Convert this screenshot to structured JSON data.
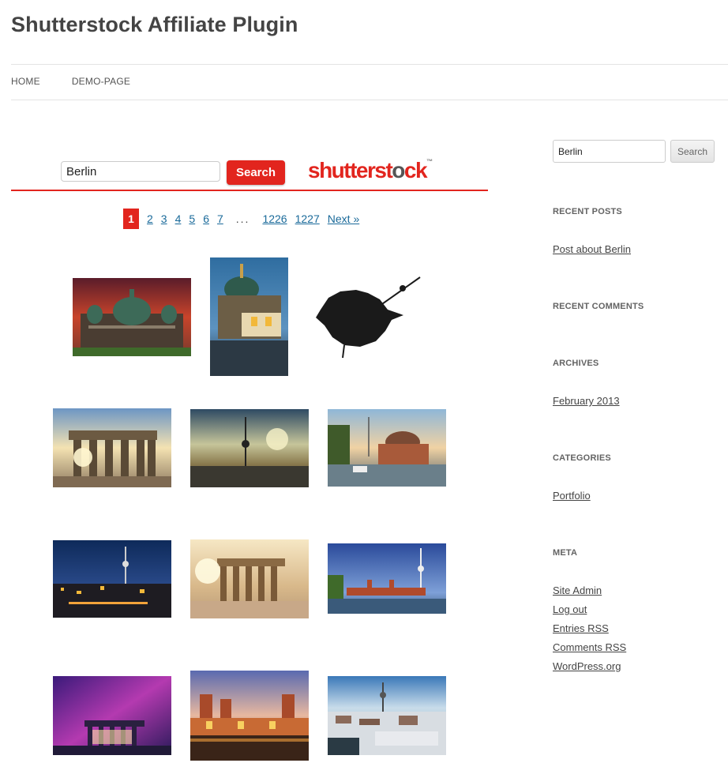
{
  "site": {
    "title": "Shutterstock Affiliate Plugin"
  },
  "nav": {
    "items": [
      "HOME",
      "DEMO-PAGE"
    ]
  },
  "widget": {
    "search_value": "Berlin",
    "search_button": "Search",
    "logo_red": "shutterst",
    "logo_grey1": "o",
    "logo_red2": "ck",
    "brand_color": "#e2251e"
  },
  "pager": {
    "current": "1",
    "pages": [
      "2",
      "3",
      "4",
      "5",
      "6",
      "7"
    ],
    "dots": "...",
    "last_pages": [
      "1226",
      "1227"
    ],
    "next": "Next »"
  },
  "images": [
    {
      "subject": "berlin-cathedral-red-sky"
    },
    {
      "subject": "berlin-cathedral-river"
    },
    {
      "subject": "berlin-silhouette-tv-tower"
    },
    {
      "subject": "brandenburg-gate-sunrise"
    },
    {
      "subject": "tv-tower-skyline-sunset"
    },
    {
      "subject": "bode-museum-river-boat"
    },
    {
      "subject": "berlin-night-skyline"
    },
    {
      "subject": "brandenburg-gate-sunburst"
    },
    {
      "subject": "oberbaum-bridge-tv-tower"
    },
    {
      "subject": "brandenburg-gate-purple-sky"
    },
    {
      "subject": "oberbaum-bridge-night"
    },
    {
      "subject": "berlin-winter-aerial"
    }
  ],
  "sidebar": {
    "search_value": "Berlin",
    "search_button": "Search",
    "recent_posts": {
      "heading": "RECENT POSTS",
      "items": [
        "Post about Berlin"
      ]
    },
    "recent_comments": {
      "heading": "RECENT COMMENTS"
    },
    "archives": {
      "heading": "ARCHIVES",
      "items": [
        "February 2013"
      ]
    },
    "categories": {
      "heading": "CATEGORIES",
      "items": [
        "Portfolio"
      ]
    },
    "meta": {
      "heading": "META",
      "items": [
        "Site Admin",
        "Log out",
        "Entries RSS",
        "Comments RSS",
        "WordPress.org"
      ]
    }
  }
}
